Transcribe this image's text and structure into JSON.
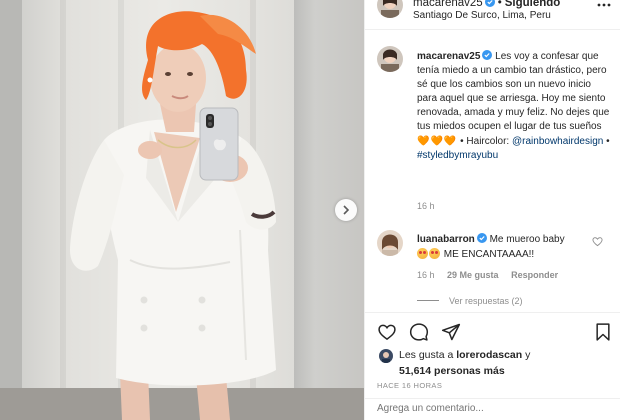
{
  "colors": {
    "accent_link": "#00376b",
    "verified": "#3897f0",
    "muted": "#8e8e8e",
    "hair": "#f3722c"
  },
  "header": {
    "username": "macarenav25",
    "separator": "•",
    "follow_label": "Siguiendo",
    "location": "Santiago De Surco, Lima, Peru"
  },
  "caption": {
    "username": "macarenav25",
    "body": "Les voy a confesar que tenía miedo a un cambio tan drástico, pero sé que los cambios son un nuevo inicio para aquel que se arriesga. Hoy me siento renovada, amada y muy feliz. No dejes que tus miedos ocupen el lugar de tus sueños",
    "hearts": "🧡🧡🧡",
    "tail": " • Haircolor:",
    "mention": "@rainbowhairdesign",
    "mention_sep": " •",
    "hashtag": "#styledbymrayubu",
    "timestamp": "16 h"
  },
  "comment": {
    "username": "luanabarron",
    "text_1": "Me mueroo baby",
    "text_2": "ME ENCANTAAAA!!",
    "time": "16 h",
    "likes": "29 Me gusta",
    "reply_label": "Responder",
    "view_replies": "Ver respuestas (2)"
  },
  "actions": {
    "like_icon": "heart-icon",
    "comment_icon": "comment-icon",
    "share_icon": "share-icon",
    "save_icon": "bookmark-icon"
  },
  "likes": {
    "prefix": "Les gusta a ",
    "liker": "lorerodascan",
    "suffix": " y",
    "count": "51,614",
    "count_suffix": " personas más"
  },
  "time_ago": "HACE 16 HORAS",
  "add_comment": {
    "placeholder": "Agrega un comentario..."
  }
}
